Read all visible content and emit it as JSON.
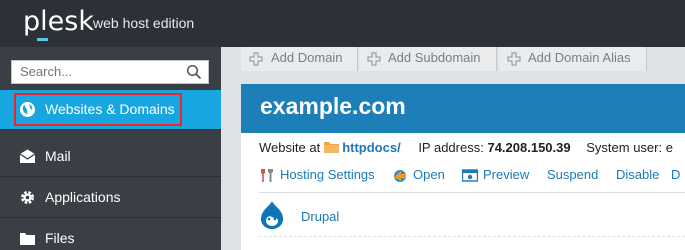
{
  "header": {
    "logo": "plesk",
    "edition": "web host edition"
  },
  "sidebar": {
    "search_placeholder": "Search...",
    "items": [
      {
        "label": "Websites & Domains",
        "icon": "globe-icon",
        "active": true
      },
      {
        "label": "Mail",
        "icon": "mail-icon"
      },
      {
        "label": "Applications",
        "icon": "gear-icon"
      },
      {
        "label": "Files",
        "icon": "folder-icon"
      }
    ]
  },
  "tabs": [
    {
      "label": "Add Domain"
    },
    {
      "label": "Add Subdomain"
    },
    {
      "label": "Add Domain Alias"
    }
  ],
  "domain": {
    "name": "example.com",
    "website_at": "Website at",
    "docroot": "httpdocs/",
    "ip_label": "IP address:",
    "ip_value": "74.208.150.39",
    "system_user_label": "System user: e"
  },
  "actions": [
    {
      "label": "Hosting Settings",
      "icon": "wrench-icon"
    },
    {
      "label": "Open",
      "icon": "open-icon"
    },
    {
      "label": "Preview",
      "icon": "preview-icon"
    },
    {
      "label": "Suspend"
    },
    {
      "label": "Disable"
    },
    {
      "label": "D"
    }
  ],
  "apps": [
    {
      "label": "Drupal",
      "icon": "drupal-icon"
    }
  ],
  "colors": {
    "topbar": "#2d3137",
    "sidebar": "#3a3f45",
    "active": "#17a6e0",
    "highlight": "#e8262b",
    "panel_head": "#1d7fb7",
    "link": "#1a7ab5"
  }
}
